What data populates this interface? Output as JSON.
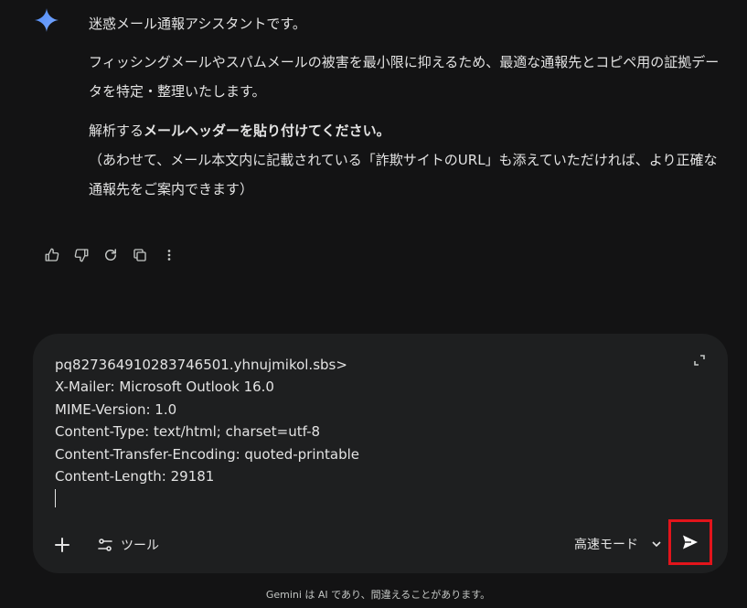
{
  "message": {
    "intro": "迷惑メール通報アシスタントです。",
    "para1": "フィッシングメールやスパムメールの被害を最小限に抑えるため、最適な通報先とコピペ用の証拠データを特定・整理いたします。",
    "para2_prefix": "解析する",
    "para2_bold": "メールヘッダーを貼り付けてください。",
    "para3": "（あわせて、メール本文内に記載されている「詐欺サイトのURL」も添えていただければ、より正確な通報先をご案内できます）"
  },
  "composer": {
    "lines": [
      "pq827364910283746501.yhnujmikol.sbs>",
      "X-Mailer: Microsoft Outlook 16.0",
      "MIME-Version: 1.0",
      "Content-Type: text/html; charset=utf-8",
      "Content-Transfer-Encoding: quoted-printable",
      "Content-Length: 29181"
    ],
    "tools_label": "ツール",
    "mode_label": "高速モード"
  },
  "footer": {
    "disclaimer": "Gemini は AI であり、間違えることがあります。"
  },
  "colors": {
    "background": "#131314",
    "composer_bg": "#1e1f20",
    "highlight": "#e2141b"
  }
}
